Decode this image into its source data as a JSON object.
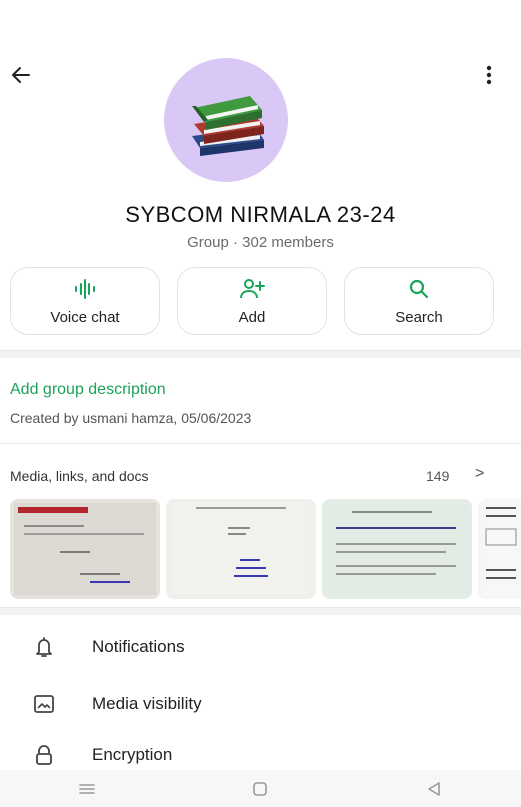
{
  "header": {
    "group_name": "SYBCOM NIRMALA 23-24",
    "subtitle": "Group · 302 members"
  },
  "actions": [
    {
      "label": "Voice chat",
      "icon": "voice-waveform-icon"
    },
    {
      "label": "Add",
      "icon": "add-person-icon"
    },
    {
      "label": "Search",
      "icon": "search-icon"
    }
  ],
  "description": {
    "add_label": "Add group description",
    "created": "Created by usmani hamza, 05/06/2023"
  },
  "media": {
    "title": "Media, links, and docs",
    "count": "149",
    "arrow": ">"
  },
  "settings": [
    {
      "label": "Notifications",
      "icon": "bell-icon"
    },
    {
      "label": "Media visibility",
      "icon": "image-icon"
    },
    {
      "label": "Encryption",
      "icon": "lock-icon"
    }
  ],
  "colors": {
    "accent": "#1aa35a",
    "avatar_bg": "#d9c8f5"
  }
}
